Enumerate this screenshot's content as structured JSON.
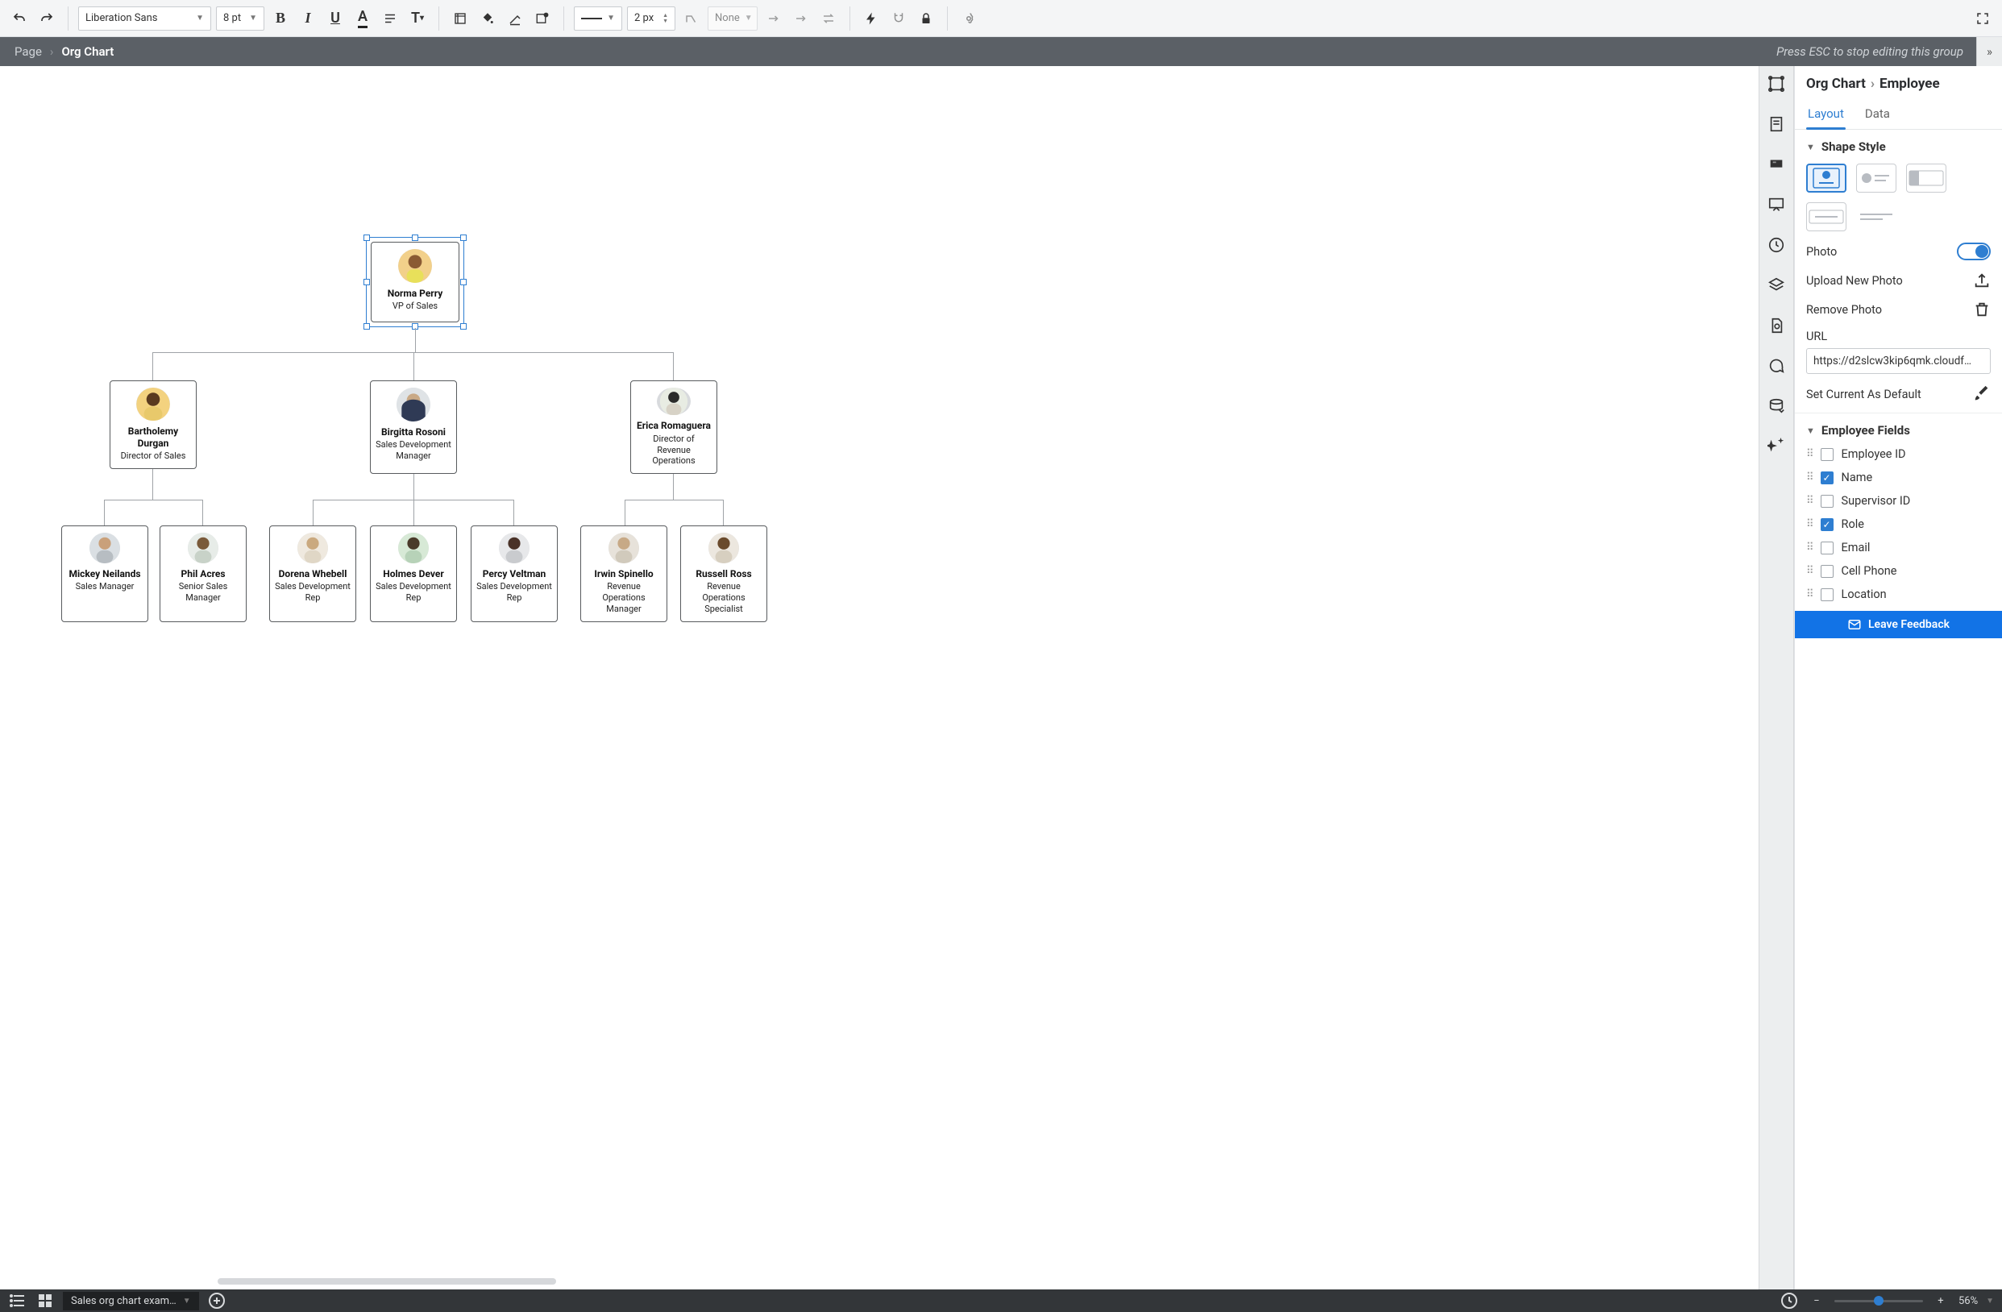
{
  "toolbar": {
    "font_family": "Liberation Sans",
    "font_size": "8 pt",
    "line_style_width": "2 px",
    "shape_lib": "None"
  },
  "crumb": {
    "root": "Page",
    "current": "Org Chart",
    "hint": "Press ESC to stop editing this group"
  },
  "inspector": {
    "title_root": "Org Chart",
    "title_leaf": "Employee",
    "tabs": {
      "layout": "Layout",
      "data": "Data"
    },
    "shape_style": "Shape Style",
    "photo_label": "Photo",
    "upload_label": "Upload New Photo",
    "remove_label": "Remove Photo",
    "url_label": "URL",
    "url_value": "https://d2slcw3kip6qmk.cloudf…",
    "set_default": "Set Current As Default",
    "fields_header": "Employee Fields",
    "fields": [
      {
        "label": "Employee ID",
        "checked": false
      },
      {
        "label": "Name",
        "checked": true
      },
      {
        "label": "Supervisor ID",
        "checked": false
      },
      {
        "label": "Role",
        "checked": true
      },
      {
        "label": "Email",
        "checked": false
      },
      {
        "label": "Cell Phone",
        "checked": false
      },
      {
        "label": "Location",
        "checked": false
      }
    ]
  },
  "feedback": "Leave Feedback",
  "bottom": {
    "tab_label": "Sales org chart exam…",
    "zoom": "56%"
  },
  "chart_data": {
    "type": "org-chart",
    "root": {
      "name": "Norma Perry",
      "role": "VP of Sales",
      "children": [
        {
          "name": "Bartholemy Durgan",
          "role": "Director of Sales",
          "children": [
            {
              "name": "Mickey Neilands",
              "role": "Sales Manager"
            },
            {
              "name": "Phil Acres",
              "role": "Senior Sales Manager"
            }
          ]
        },
        {
          "name": "Birgitta Rosoni",
          "role": "Sales Development Manager",
          "children": [
            {
              "name": "Dorena Whebell",
              "role": "Sales Development Rep"
            },
            {
              "name": "Holmes Dever",
              "role": "Sales Development Rep"
            },
            {
              "name": "Percy Veltman",
              "role": "Sales Development Rep"
            }
          ]
        },
        {
          "name": "Erica Romaguera",
          "role": "Director of Revenue Operations",
          "children": [
            {
              "name": "Irwin Spinello",
              "role": "Revenue Operations Manager"
            },
            {
              "name": "Russell Ross",
              "role": "Revenue Operations Specialist"
            }
          ]
        }
      ]
    }
  }
}
